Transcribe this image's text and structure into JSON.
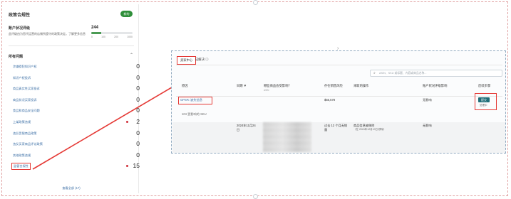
{
  "left_panel": {
    "header_title": "政策合规性",
    "toggle_label": "新的",
    "account_health": {
      "title": "账户状况评级",
      "description": "此评级由为您代运营的店铺所遵守的政策决定。了解更多信息",
      "value": "244",
      "progress": 0.244,
      "ticks": [
        "0",
        "100",
        "200",
        "1000"
      ]
    },
    "issues_title": "所有问题",
    "issues": [
      {
        "label": "涉嫌侵犯知识产权",
        "count": "0",
        "flag": false,
        "highlight": false
      },
      {
        "label": "知识产权投诉",
        "count": "0",
        "flag": false,
        "highlight": false
      },
      {
        "label": "商品真实性买家投诉",
        "count": "0",
        "flag": false,
        "highlight": false
      },
      {
        "label": "商品状况买家投诉",
        "count": "0",
        "flag": false,
        "highlight": false
      },
      {
        "label": "食品和商品安全问题",
        "count": "0",
        "flag": false,
        "highlight": false
      },
      {
        "label": "上架政策违规",
        "count": "2",
        "flag": true,
        "highlight": false
      },
      {
        "label": "违反受限商品政策",
        "count": "0",
        "flag": false,
        "highlight": false
      },
      {
        "label": "违反买家商品评论政策",
        "count": "0",
        "flag": false,
        "highlight": false
      },
      {
        "label": "其他政策违规",
        "count": "0",
        "flag": false,
        "highlight": false
      },
      {
        "label": "监管合规性",
        "count": "15",
        "flag": true,
        "highlight": true
      }
    ],
    "view_all": "查看全部 (17)"
  },
  "right_panel": {
    "tabs": [
      "卖家中心",
      "已解决 ⓘ"
    ],
    "search_placeholder": "ASIN、SKU 或标题、内容或商品名称...",
    "columns": [
      {
        "label": "原因",
        "sub": ""
      },
      {
        "label": "日期 ▼",
        "sub": ""
      },
      {
        "label": "哪些商品会受影响？",
        "sub": "ASIN"
      },
      {
        "label": "存在销售风险",
        "sub": ""
      },
      {
        "label": "采取的操作",
        "sub": ""
      },
      {
        "label": "账户状况评级影响",
        "sub": ""
      },
      {
        "label": "后续步骤",
        "sub": ""
      }
    ],
    "row1": {
      "reason": "GPSR: 缺失信息",
      "sub_note": "104 受影响的 SKU",
      "price": "$55,578",
      "impact": "无影响",
      "action_button": "提交",
      "action_note": "处理中"
    },
    "row2": {
      "date": "2024年11月24日",
      "risk": "过去 12 个月无销量",
      "action": "商品信息被移除",
      "action_sub": "（在 2024年12月10日 移除）",
      "impact": "无影响"
    }
  },
  "colors": {
    "accent_red": "#e53935",
    "link_blue": "#3a6ea5",
    "button_teal": "#1f6d78",
    "toggle_green": "#2f8f3a"
  }
}
